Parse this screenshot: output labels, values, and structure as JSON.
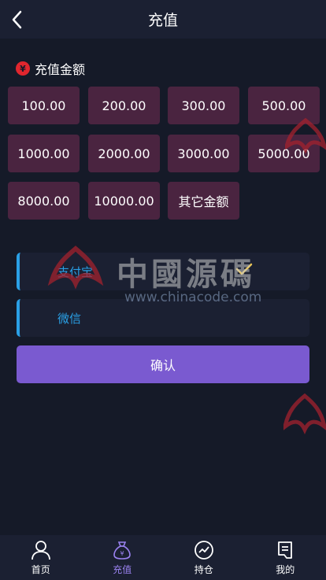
{
  "header": {
    "title": "充值"
  },
  "section": {
    "label": "充值金额"
  },
  "amounts": [
    "100.00",
    "200.00",
    "300.00",
    "500.00",
    "1000.00",
    "2000.00",
    "3000.00",
    "5000.00",
    "8000.00",
    "10000.00",
    "其它金额"
  ],
  "payment": {
    "alipay": "支付宝",
    "wechat": "微信"
  },
  "confirm_label": "确认",
  "tabs": [
    {
      "label": "首页",
      "icon": "user-icon"
    },
    {
      "label": "充值",
      "icon": "money-bag-icon"
    },
    {
      "label": "持仓",
      "icon": "chart-icon"
    },
    {
      "label": "我的",
      "icon": "document-icon"
    }
  ],
  "watermark": {
    "logo_text": "中國源碼",
    "url": "www.chinacode.com"
  },
  "colors": {
    "background": "#151a28",
    "panel": "#1b2032",
    "amount_button": "#4a2440",
    "accent_blue": "#2aa0e6",
    "confirm": "#7a5ad0",
    "active_tab": "#9a82f0"
  }
}
